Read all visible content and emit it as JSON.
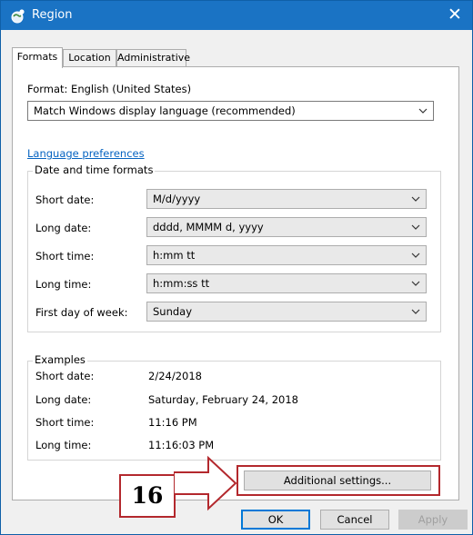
{
  "window": {
    "title": "Region",
    "close_glyph": "✕",
    "icon": "region-globe-icon"
  },
  "tabs": [
    {
      "label": "Formats",
      "active": true
    },
    {
      "label": "Location",
      "active": false
    },
    {
      "label": "Administrative",
      "active": false
    }
  ],
  "format": {
    "label": "Format: English (United States)",
    "selected": "Match Windows display language (recommended)"
  },
  "language_preferences_link": "Language preferences",
  "date_time_formats": {
    "title": "Date and time formats",
    "rows": [
      {
        "label": "Short date:",
        "value": "M/d/yyyy"
      },
      {
        "label": "Long date:",
        "value": "dddd, MMMM d, yyyy"
      },
      {
        "label": "Short time:",
        "value": "h:mm tt"
      },
      {
        "label": "Long time:",
        "value": "h:mm:ss tt"
      },
      {
        "label": "First day of week:",
        "value": "Sunday"
      }
    ]
  },
  "examples": {
    "title": "Examples",
    "rows": [
      {
        "label": "Short date:",
        "value": "2/24/2018"
      },
      {
        "label": "Long date:",
        "value": "Saturday, February 24, 2018"
      },
      {
        "label": "Short time:",
        "value": "11:16 PM"
      },
      {
        "label": "Long time:",
        "value": "11:16:03 PM"
      }
    ]
  },
  "buttons": {
    "additional_settings": "Additional settings...",
    "ok": "OK",
    "cancel": "Cancel",
    "apply": "Apply"
  },
  "annotation": {
    "step_number": "16",
    "color": "#b3282d"
  },
  "colors": {
    "titlebar": "#1a73c4",
    "link": "#0563c1",
    "highlight": "#b3282d"
  }
}
